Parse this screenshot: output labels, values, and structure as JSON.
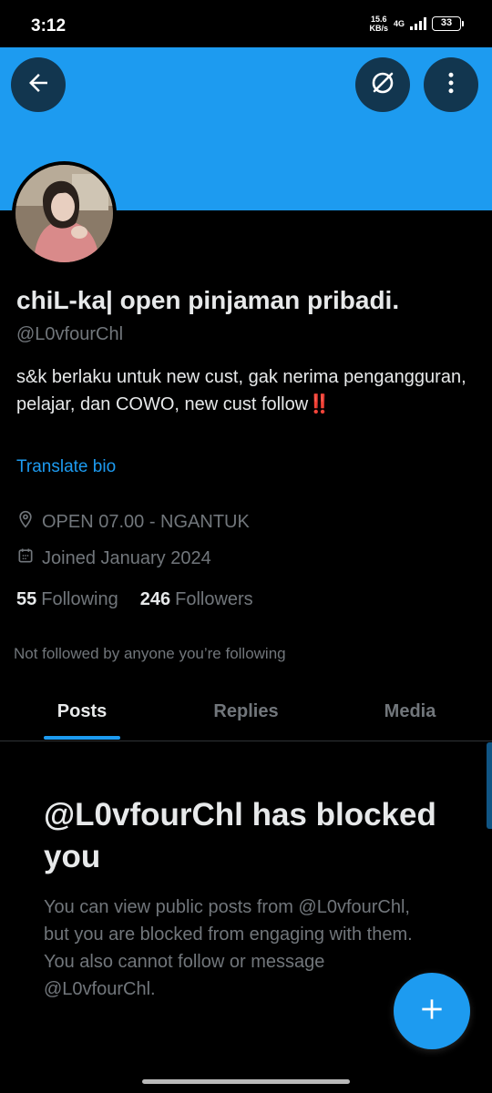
{
  "status_bar": {
    "time": "3:12",
    "net_speed_value": "15.6",
    "net_speed_unit": "KB/s",
    "network_type": "4G",
    "battery": "33"
  },
  "header": {
    "back_icon": "arrow-left-icon",
    "grok_icon": "grok-icon",
    "more_icon": "more-vertical-icon"
  },
  "profile": {
    "display_name": "chiL-ka| open pinjaman pribadi.",
    "handle": "@L0vfourChl",
    "bio_text": "s&k berlaku untuk new cust, gak nerima pengangguran, pelajar, dan COWO, new cust follow",
    "bio_emoji": "‼️",
    "translate_label": "Translate bio",
    "location": "OPEN 07.00 - NGANTUK",
    "joined": "Joined January 2024",
    "following_count": "55",
    "following_label": "Following",
    "followers_count": "246",
    "followers_label": "Followers",
    "not_followed_text": "Not followed by anyone you’re following"
  },
  "tabs": [
    {
      "label": "Posts",
      "active": true
    },
    {
      "label": "Replies",
      "active": false
    },
    {
      "label": "Media",
      "active": false
    }
  ],
  "blocked": {
    "title": "@L0vfourChl has blocked you",
    "description": "You can view public posts from @L0vfourChl, but you are blocked from engaging with them. You also cannot follow or message @L0vfourChl."
  },
  "colors": {
    "accent": "#1d9bf0",
    "background": "#000000",
    "text_primary": "#e7e9ea",
    "text_secondary": "#71767b"
  }
}
